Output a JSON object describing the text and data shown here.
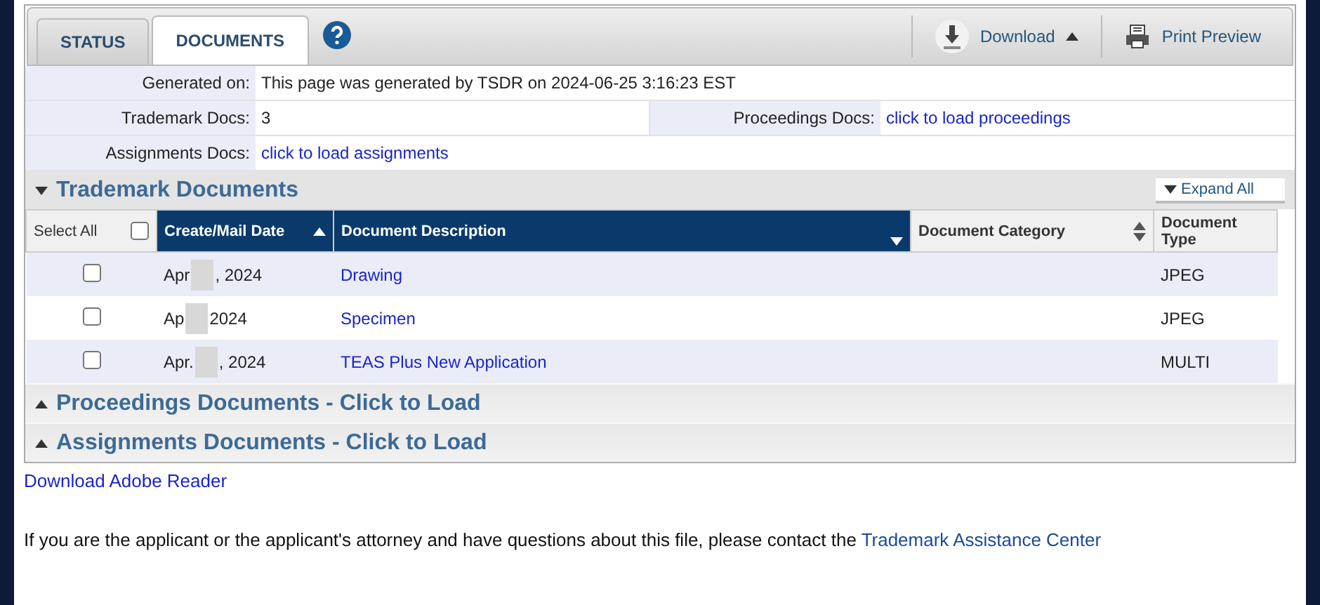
{
  "tabs": [
    {
      "label": "STATUS",
      "selected": false
    },
    {
      "label": "DOCUMENTS",
      "selected": true
    }
  ],
  "toolbar": {
    "download": "Download",
    "print": "Print Preview"
  },
  "info": {
    "generated_label": "Generated on:",
    "generated_value": "This page was generated by TSDR on 2024-06-25 3:16:23 EST",
    "trademark_label": "Trademark Docs:",
    "trademark_value": "3",
    "proceedings_label": "Proceedings Docs:",
    "proceedings_link": "click to load proceedings",
    "assignments_label": "Assignments Docs:",
    "assignments_link": "click to load assignments"
  },
  "trademark_section": {
    "title": "Trademark Documents",
    "expanded": true,
    "expand_all": "Expand All"
  },
  "table": {
    "select_all": {
      "label": "Select All",
      "checked": false
    },
    "columns": [
      {
        "label": "Create/Mail Date",
        "sorted": true
      },
      {
        "label": "Document Description",
        "sorted": true
      },
      {
        "label": "Document Category",
        "sorted": false
      },
      {
        "label": "Document Type",
        "sorted": false
      }
    ],
    "rows": [
      {
        "checked": false,
        "date_start": "Apr",
        "date_end": ", 2024",
        "description": "Drawing",
        "type": "JPEG"
      },
      {
        "checked": false,
        "date_start": "Ap",
        "date_end": "2024",
        "description": "Specimen",
        "type": "JPEG"
      },
      {
        "checked": false,
        "date_start": "Apr.",
        "date_end": ", 2024",
        "description": "TEAS Plus New Application",
        "type": "MULTI"
      }
    ]
  },
  "collapsed_sections": [
    {
      "title": "Proceedings Documents - Click to Load",
      "expanded": false
    },
    {
      "title": "Assignments Documents - Click to Load",
      "expanded": false
    }
  ],
  "adobe_link": "Download Adobe Reader",
  "contact": {
    "text": "If you are the applicant or the applicant's attorney and have questions about this file, please contact the",
    "link": "Trademark Assistance Center"
  }
}
